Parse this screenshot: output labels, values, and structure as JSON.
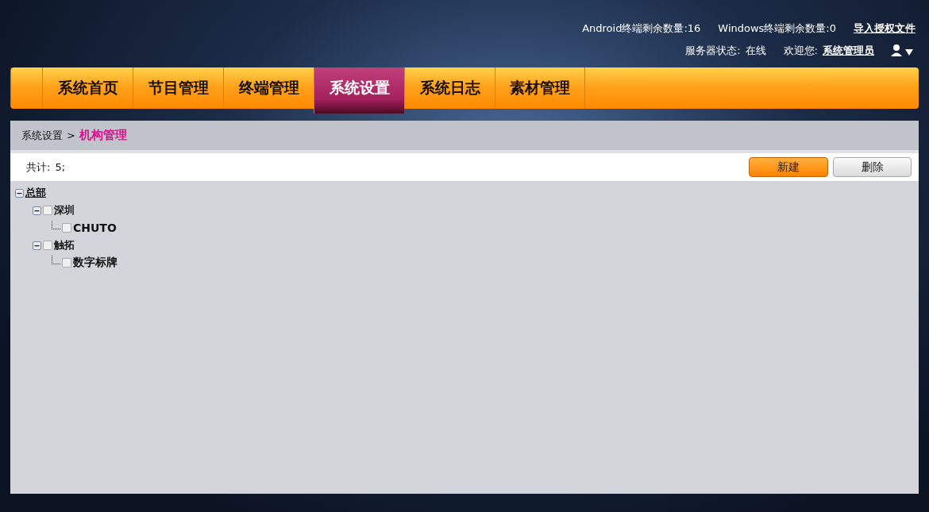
{
  "header": {
    "counters": [
      "Android终端剩余数量:16",
      "Windows终端剩余数量:0"
    ],
    "import_link": "导入授权文件",
    "server_status_label": "服务器状态:",
    "server_status": "在线",
    "welcome_label": "欢迎您:",
    "user": "系统管理员"
  },
  "nav": [
    {
      "label": "系统首页",
      "selected": false
    },
    {
      "label": "节目管理",
      "selected": false
    },
    {
      "label": "终端管理",
      "selected": false
    },
    {
      "label": "系统设置",
      "selected": true
    },
    {
      "label": "系统日志",
      "selected": false
    },
    {
      "label": "素材管理",
      "selected": false
    }
  ],
  "breadcrumb": {
    "parent": "系统设置",
    "separator": ">",
    "current": "机构管理"
  },
  "toolbar": {
    "total_label": "共计:",
    "total": "5;",
    "buttons": [
      {
        "label": "新建",
        "kind": "primary"
      },
      {
        "label": "删除",
        "kind": "secondary"
      }
    ]
  },
  "tree": [
    {
      "label": "总部",
      "expanded": true,
      "underlined": true,
      "children": [
        {
          "label": "深圳",
          "expanded": true,
          "checked": false,
          "children": [
            {
              "label": "CHUTO",
              "checked": false
            }
          ]
        },
        {
          "label": "触拓",
          "expanded": true,
          "checked": false,
          "children": [
            {
              "label": "数字标牌",
              "checked": false
            }
          ]
        }
      ]
    }
  ]
}
